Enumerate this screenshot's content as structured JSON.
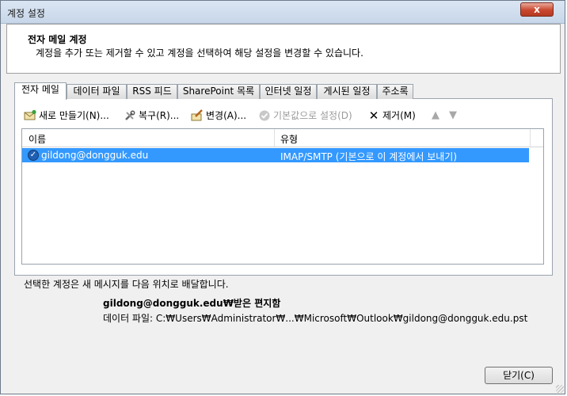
{
  "window": {
    "title": "계정 설정",
    "close_label": "x"
  },
  "header": {
    "title": "전자 메일 계정",
    "description": "계정을 추가 또는 제거할 수 있고 계정을 선택하여 해당 설정을 변경할 수 있습니다."
  },
  "tabs": [
    {
      "label": "전자 메일"
    },
    {
      "label": "데이터 파일"
    },
    {
      "label": "RSS 피드"
    },
    {
      "label": "SharePoint 목록"
    },
    {
      "label": "인터넷 일정"
    },
    {
      "label": "게시된 일정"
    },
    {
      "label": "주소록"
    }
  ],
  "toolbar": {
    "new": "새로 만들기(N)...",
    "repair": "복구(R)...",
    "change": "변경(A)...",
    "set_default": "기본값으로 설정(D)",
    "remove": "제거(M)"
  },
  "list": {
    "columns": {
      "name": "이름",
      "type": "유형"
    },
    "rows": [
      {
        "name": "gildong@dongguk.edu",
        "type": "IMAP/SMTP (기본으로 이 계정에서 보내기)"
      }
    ]
  },
  "delivery": {
    "label": "선택한 계정은 새 메시지를 다음 위치로 배달합니다.",
    "folder": "gildong@dongguk.edu₩받은 편지함",
    "data_file": "데이터 파일: C:₩Users₩Administrator₩...₩Microsoft₩Outlook₩gildong@dongguk.edu.pst"
  },
  "footer": {
    "close_button": "닫기(C)"
  },
  "colors": {
    "selection": "#3399ff",
    "close_red": "#c9472e"
  }
}
